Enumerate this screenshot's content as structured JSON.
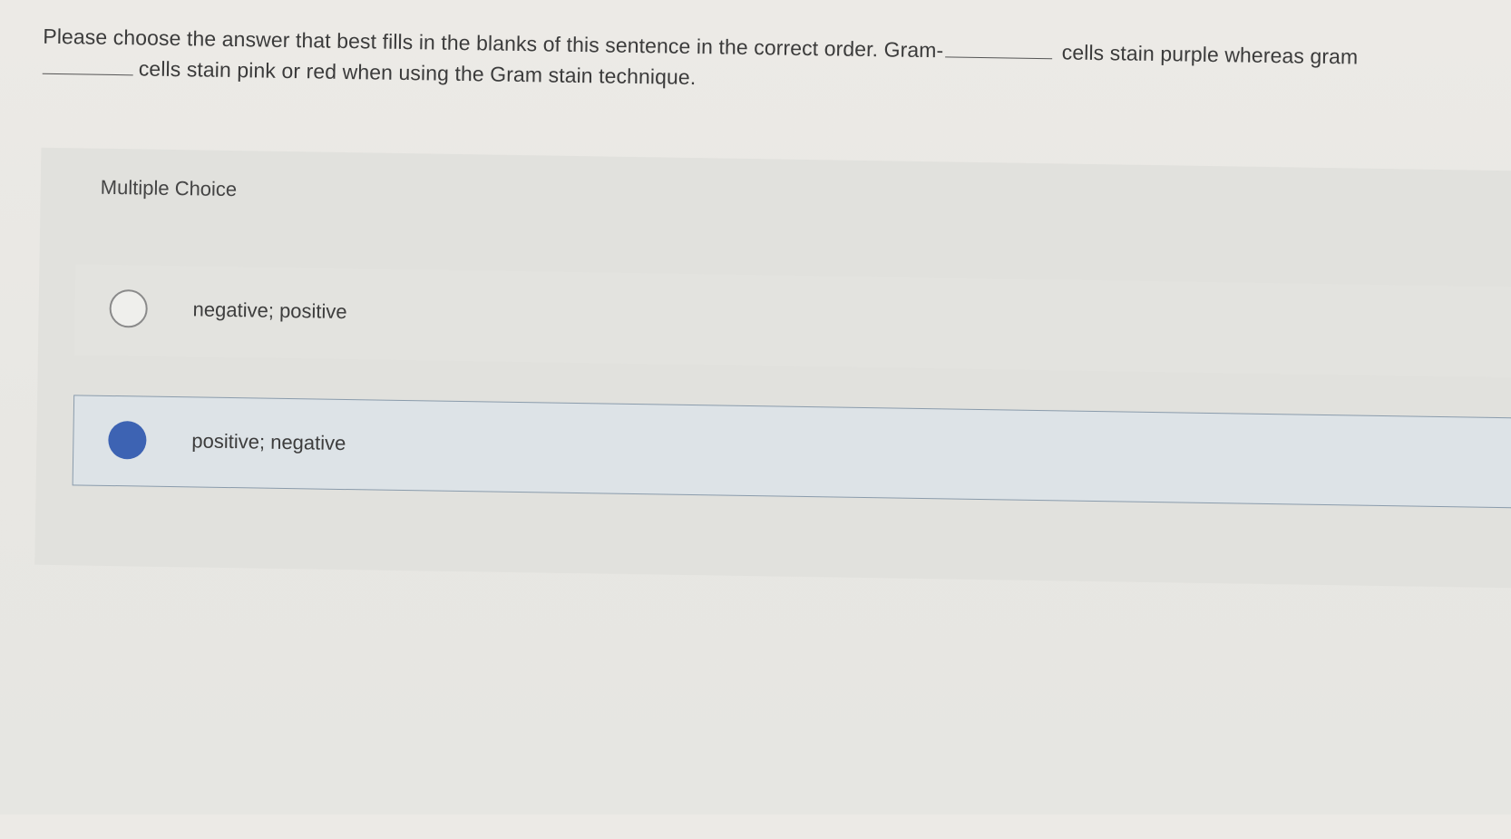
{
  "question": {
    "line1_start": "Please choose the answer that best fills in the blanks of this sentence in the correct order. Gram-",
    "line1_end": "cells stain purple whereas gram",
    "line2_end": "cells stain pink or red when using the Gram stain technique."
  },
  "multiple_choice": {
    "label": "Multiple Choice",
    "options": [
      {
        "label": "negative; positive",
        "selected": false
      },
      {
        "label": "positive; negative",
        "selected": true
      }
    ]
  },
  "colors": {
    "selected_radio": "#3d63b3",
    "selected_border": "#8a9bab"
  }
}
